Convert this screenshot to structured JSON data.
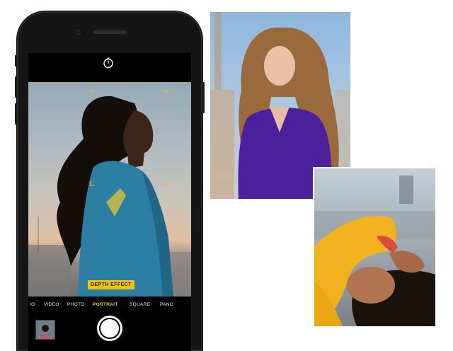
{
  "camera": {
    "timer_icon": "timer-icon",
    "depth_effect_label": "DEPTH EFFECT",
    "modes": [
      {
        "label": "IO"
      },
      {
        "label": "VIDEO"
      },
      {
        "label": "PHOTO"
      },
      {
        "label": "PORTRAIT"
      },
      {
        "label": "SQUARE"
      },
      {
        "label": "PANO"
      }
    ],
    "active_mode": "PORTRAIT",
    "accent_color": "#f4c400"
  },
  "colors": {
    "background": "#ffffff",
    "phone_body": "#151515",
    "focus_bracket": "#e8b924"
  }
}
